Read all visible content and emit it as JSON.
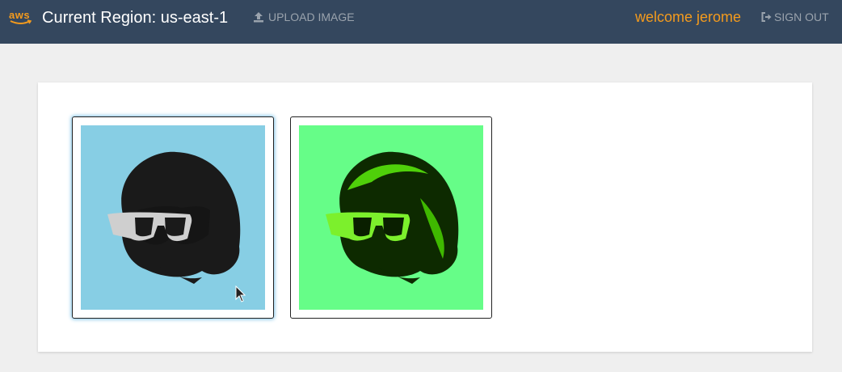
{
  "header": {
    "logo_text": "aws",
    "region_label": "Current Region: us-east-1",
    "upload_label": "UPLOAD IMAGE",
    "welcome_text": "welcome jerome",
    "signout_label": "SIGN OUT"
  },
  "colors": {
    "topbar": "#34475e",
    "accent": "#f49b1d",
    "muted_link": "#9aa3ad",
    "original_bg": "#87cee4",
    "processed_bg": "#66fd88"
  },
  "gallery": {
    "images": [
      {
        "name": "original-image",
        "background": "#87cee4",
        "tint": "natural",
        "selected": true
      },
      {
        "name": "processed-image",
        "background": "#66fd88",
        "tint": "green",
        "selected": false
      }
    ]
  }
}
